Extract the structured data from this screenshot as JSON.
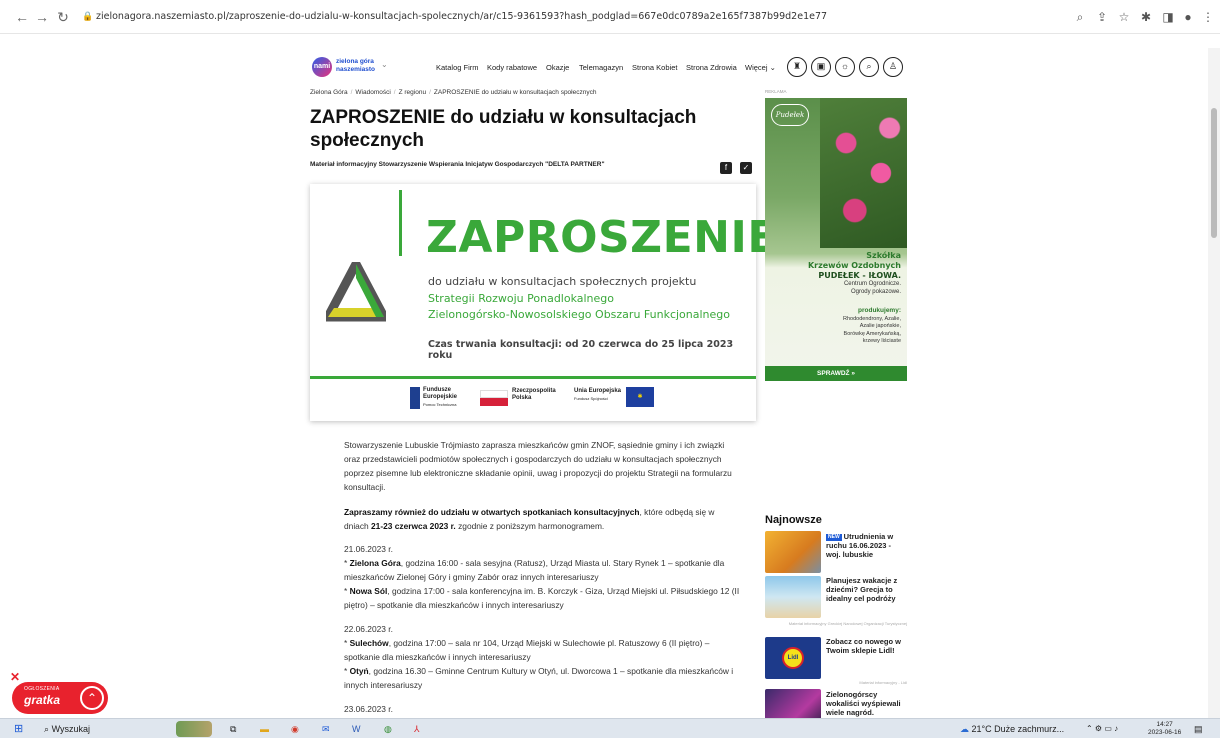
{
  "browser": {
    "url": "zielonagora.naszemiasto.pl/zaproszenie-do-udzialu-w-konsultacjach-spolecznych/ar/c15-9361593?hash_podglad=667e0dc0789a2e165f7387b99d2e1e77"
  },
  "site": {
    "logo_badge": "nami",
    "logo_line1": "zielona góra",
    "logo_line2": "naszemiasto",
    "nav": [
      "Katalog Firm",
      "Kody rabatowe",
      "Okazje",
      "Telemagazyn",
      "Strona Kobiet",
      "Strona Zdrowia",
      "Więcej"
    ]
  },
  "breadcrumb": [
    "Zielona Góra",
    "Wiadomości",
    "Z regionu",
    "ZAPROSZENIE do udziału w konsultacjach społecznych"
  ],
  "article": {
    "title": "ZAPROSZENIE do udziału w konsultacjach społecznych",
    "sponsor": "Materiał informacyjny Stowarzyszenie Wspierania Inicjatyw Gospodarczych \"DELTA PARTNER\"",
    "banner": {
      "heading": "ZAPROSZENIE",
      "line1": "do udziału w konsultacjach społecznych projektu",
      "line2": "Strategii Rozwoju Ponadlokalnego",
      "line3": "Zielonogórsko-Nowosolskiego Obszaru Funkcjonalnego",
      "dates": "Czas trwania konsultacji: od 20 czerwca do 25 lipca 2023 roku",
      "logo1_a": "Fundusze",
      "logo1_b": "Europejskie",
      "logo1_c": "Pomoc Techniczna",
      "logo2_a": "Rzeczpospolita",
      "logo2_b": "Polska",
      "logo3_a": "Unia Europejska",
      "logo3_b": "Fundusz Spójności"
    },
    "p1": "Stowarzyszenie Lubuskie Trójmiasto zaprasza mieszkańców gmin ZNOF, sąsiednie gminy i ich związki oraz przedstawicieli podmiotów społecznych i gospodarczych do udziału w konsultacjach społecznych poprzez pisemne lub elektroniczne składanie opinii, uwag i propozycji do projektu Strategii na formularzu konsultacji.",
    "p2_bold": "Zapraszamy również do udziału w otwartych spotkaniach konsultacyjnych",
    "p2_mid": ", które odbędą się w dniach ",
    "p2_bold2": "21-23 czerwca 2023 r.",
    "p2_end": " zgodnie z poniższym harmonogramem.",
    "date1": "21.06.2023 r.",
    "e1_city": "Zielona Góra",
    "e1_text": ", godzina 16:00 - sala sesyjna (Ratusz), Urząd Miasta ul. Stary Rynek 1 – spotkanie dla mieszkańców Zielonej Góry i gminy Zabór oraz innych interesariuszy",
    "e2_city": "Nowa Sól",
    "e2_text": ", godzina 17:00 - sala konferencyjna im. B. Korczyk - Giza, Urząd Miejski ul. Piłsudskiego 12 (II piętro) – spotkanie dla mieszkańców i innych interesariuszy",
    "date2": "22.06.2023 r.",
    "e3_city": "Sulechów",
    "e3_text": ", godzina 17:00 – sala nr 104, Urząd Miejski w Sulechowie pl. Ratuszowy 6 (II piętro) – spotkanie dla mieszkańców i innych interesariuszy",
    "e4_city": "Otyń",
    "e4_text": ", godzina 16.30 – Gminne Centrum Kultury w Otyń, ul. Dworcowa 1 – spotkanie dla mieszkańców i innych interesariuszy",
    "date3": "23.06.2023 r."
  },
  "ad": {
    "label": "REKLAMA",
    "logo": "Pudełek",
    "title1": "Szkółka",
    "title2": "Krzewów Ozdobnych",
    "title3": "PUDEŁEK - IŁOWA.",
    "sub1": "Centrum Ogrodnicze.",
    "sub2": "Ogrody pokazowe.",
    "prod_head": "produkujemy:",
    "prod1": "Rhododendrony, Azalie,",
    "prod2": "Azalie japońskie,",
    "prod3": "Borówkę Amerykańską,",
    "prod4": "krzewy liściaste",
    "button": "SPRAWDŹ »"
  },
  "najnowsze": {
    "heading": "Najnowsze",
    "items": [
      {
        "tag": "NEW",
        "title": "Utrudnienia w ruchu 16.06.2023 - woj. lubuskie"
      },
      {
        "title": "Planujesz wakacje z dziećmi? Grecja to idealny cel podróży",
        "note": "Materiał informacyjny Greckiej Narodowej Organizacji Turystycznej"
      },
      {
        "title": "Zobacz co nowego w Twoim sklepie Lidl!",
        "note": "Materiał informacyjny - Lidl"
      },
      {
        "title": "Zielonogórscy wokaliści wyśpiewali wiele nagród."
      }
    ]
  },
  "gratka": {
    "label_top": "OGŁOSZENIA",
    "label_main": "gratka"
  },
  "taskbar": {
    "search": "Wyszukaj",
    "weather": "21°C Duże zachmurz...",
    "time": "14:27",
    "date": "2023-06-16"
  },
  "colors": {
    "accent_green": "#3aa83a",
    "gratka_red": "#e8222d",
    "link_blue": "#1e5bd6"
  }
}
